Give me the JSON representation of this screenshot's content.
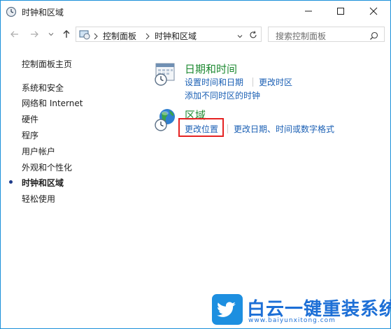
{
  "window": {
    "title": "时钟和区域",
    "accent_color": "#1a8fd9"
  },
  "address": {
    "breadcrumbs": [
      "控制面板",
      "时钟和区域"
    ],
    "search_placeholder": "搜索控制面板"
  },
  "sidebar": {
    "home": "控制面板主页",
    "items": [
      {
        "label": "系统和安全"
      },
      {
        "label": "网络和 Internet"
      },
      {
        "label": "硬件"
      },
      {
        "label": "程序"
      },
      {
        "label": "用户帐户"
      },
      {
        "label": "外观和个性化"
      },
      {
        "label": "时钟和区域"
      },
      {
        "label": "轻松使用"
      }
    ],
    "active_item": "时钟和区域"
  },
  "categories": [
    {
      "title": "日期和时间",
      "icon": "calendar-clock-icon",
      "links": [
        "设置时间和日期",
        "更改时区",
        "添加不同时区的时钟"
      ]
    },
    {
      "title": "区域",
      "icon": "globe-clock-icon",
      "links": [
        "更改位置",
        "更改日期、时间或数字格式"
      ]
    }
  ],
  "highlight_color": "#e52222",
  "watermark": {
    "brand": "白云一键重装系统",
    "url": "www.baiyunxitong.com",
    "color": "#1d6fd6",
    "icon": "twitter-bird-icon"
  }
}
